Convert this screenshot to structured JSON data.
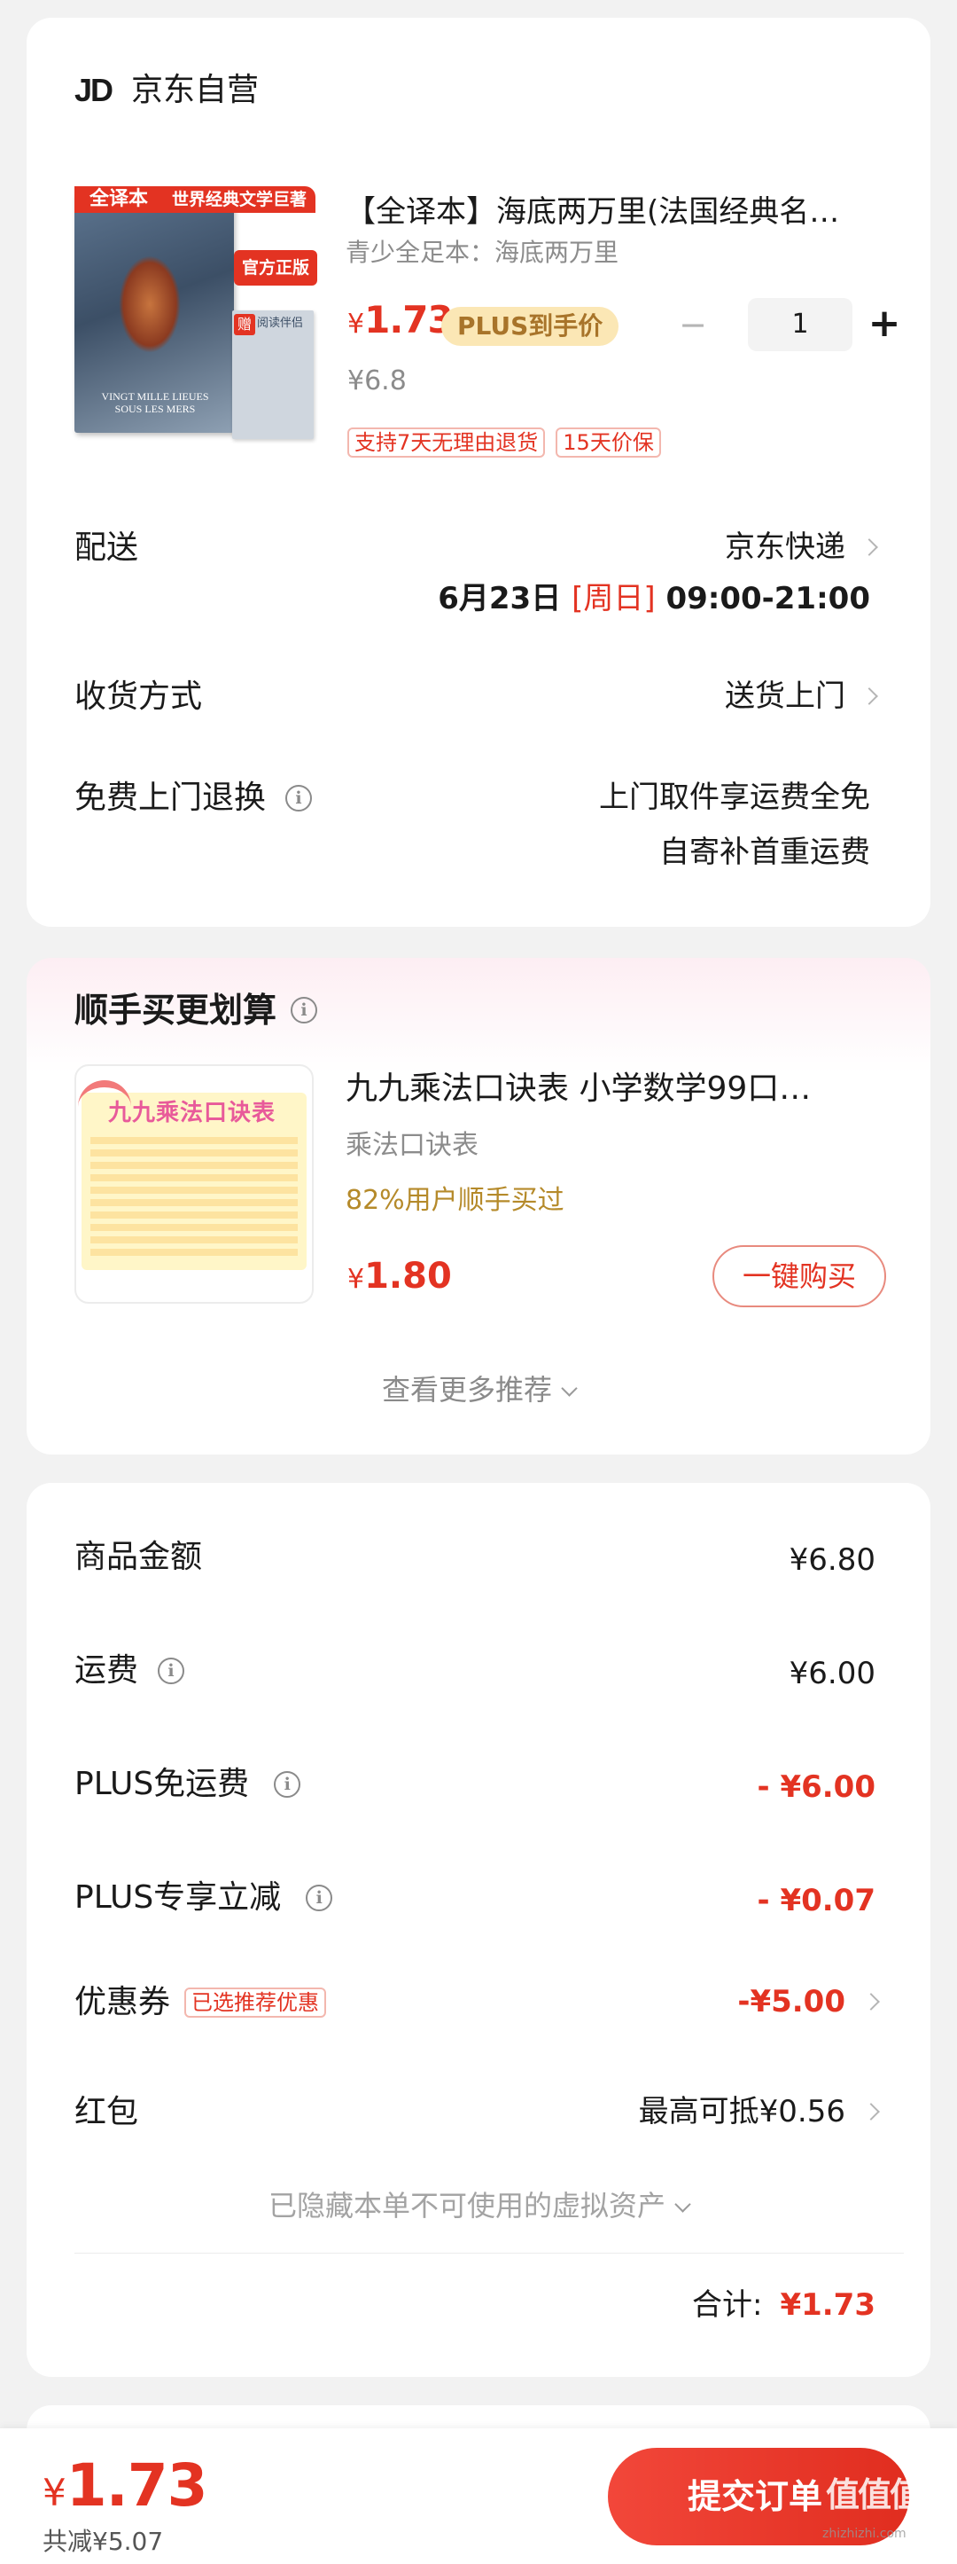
{
  "shop": {
    "logo": "JD",
    "name": "京东自营"
  },
  "product": {
    "cover_badge": "全译本",
    "cover_series": "世界经典文学巨著",
    "cover_official": "官方正版",
    "cover_gift": "赠",
    "cover_guide": "阅读伴侣",
    "cover_latin": "VINGT MILLE LIEUES SOUS LES MERS",
    "title": "【全译本】海底两万里(法国经典名…",
    "subtitle": "青少全足本：海底两万里",
    "price_symbol": "¥",
    "price": "1.73",
    "plus_label": "PLUS到手价",
    "original_price": "¥6.8",
    "quantity": "1",
    "minus": "−",
    "plus": "+",
    "tags": [
      "支持7天无理由退货",
      "15天价保"
    ]
  },
  "delivery": {
    "label": "配送",
    "carrier": "京东快递",
    "date": "6月23日",
    "weekday": "[周日]",
    "time": "09:00-21:00"
  },
  "receive": {
    "label": "收货方式",
    "value": "送货上门"
  },
  "free_return": {
    "label": "免费上门退换",
    "line1": "上门取件享运费全免",
    "line2": "自寄补首重运费"
  },
  "recommend": {
    "section_title": "顺手买更划算",
    "item_image_title": "九九乘法口诀表",
    "item_title": "九九乘法口诀表 小学数学99口…",
    "item_subtitle": "乘法口诀表",
    "item_social": "82%用户顺手买过",
    "item_price_symbol": "¥",
    "item_price": "1.80",
    "buy_button": "一键购买",
    "more": "查看更多推荐"
  },
  "summary": {
    "rows": [
      {
        "label": "商品金额",
        "value": "¥6.80"
      },
      {
        "label": "运费",
        "value": "¥6.00"
      },
      {
        "label": "PLUS免运费",
        "value": "- ¥6.00"
      },
      {
        "label": "PLUS专享立减",
        "value": "- ¥0.07"
      },
      {
        "label": "优惠券",
        "tag": "已选推荐优惠",
        "value": "-¥5.00"
      },
      {
        "label": "红包",
        "value": "最高可抵¥0.56"
      }
    ],
    "hidden_note": "已隐藏本单不可使用的虚拟资产",
    "total_label": "合计:",
    "total_value": "¥1.73"
  },
  "bottom_bar": {
    "price_symbol": "¥",
    "price": "1.73",
    "saved": "共减¥5.07",
    "submit": "提交订单",
    "watermark": "值值值",
    "watermark_url": "zhizhizhi.com"
  },
  "colors": {
    "accent_red": "#e33322",
    "plus_gold": "#a8742a",
    "plus_badge_bg": "#fbe7b5"
  }
}
